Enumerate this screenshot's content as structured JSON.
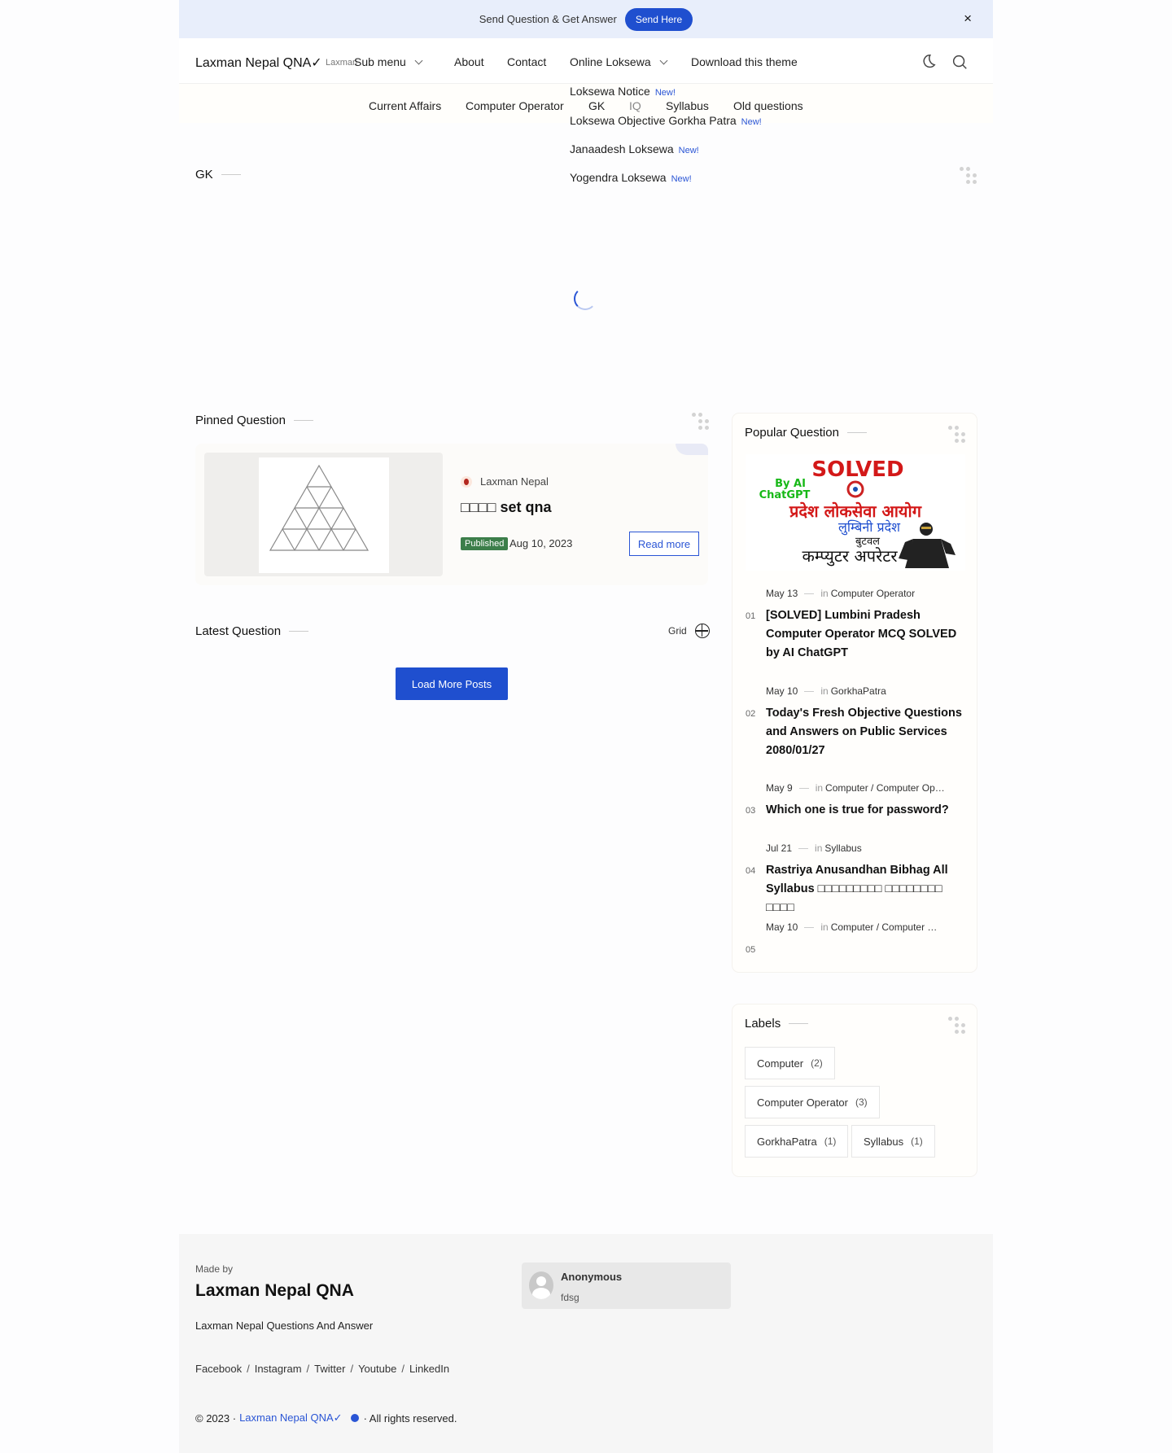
{
  "notice": {
    "text": "Send Question & Get Answer",
    "button": "Send Here",
    "close": "×"
  },
  "header": {
    "brand": "Laxman Nepal QNA✓",
    "brand_sub": "Laxman",
    "nav": {
      "submenu": "Sub menu",
      "about": "About",
      "contact": "Contact",
      "online_loksewa": "Online Loksewa",
      "download": "Download this theme"
    },
    "icons": [
      "moon-icon",
      "search-icon"
    ]
  },
  "subnav": [
    "Current Affairs",
    "Computer Operator",
    "GK",
    "IQ",
    "Syllabus",
    "Old questions"
  ],
  "dropdown": {
    "new_badge": "New!",
    "items": [
      "Loksewa Notice",
      "Loksewa Objective Gorkha Patra",
      "Janaadesh Loksewa",
      "Yogendra Loksewa"
    ]
  },
  "gk_section": {
    "title": "GK"
  },
  "pinned": {
    "title": "Pinned Question",
    "author": "Laxman Nepal",
    "post_title": "□□□□ set qna",
    "status": "Published",
    "date": "Aug 10, 2023",
    "read_more": "Read more"
  },
  "latest": {
    "title": "Latest Question",
    "toggle": "Grid",
    "load_more": "Load More Posts"
  },
  "popular": {
    "title": "Popular Question",
    "image_text": {
      "solved": "SOLVED",
      "by_ai": "By AI",
      "chatgpt": "ChatGPT",
      "line1": "प्रदेश लोकसेवा आयोग",
      "line2": "लुम्बिनी प्रदेश",
      "line3": "बुटवल",
      "line4": "कम्प्युटर अपरेटर"
    },
    "in_label": "in",
    "items": [
      {
        "num": "01",
        "date": "May 13",
        "category": "Computer Operator",
        "title": "[SOLVED] Lumbini Pradesh Computer Operator MCQ SOLVED by AI ChatGPT"
      },
      {
        "num": "02",
        "date": "May 10",
        "category": "GorkhaPatra",
        "title": "Today's Fresh Objective Questions and Answers on Public Services 2080/01/27"
      },
      {
        "num": "03",
        "date": "May 9",
        "category": "Computer / Computer Operator",
        "title": "Which one is true for password?"
      },
      {
        "num": "04",
        "date": "Jul 21",
        "category": "Syllabus",
        "title": "Rastriya Anusandhan Bibhag All Syllabus □□□□□□□□□ □□□□□□□□ □□□□"
      },
      {
        "num": "05",
        "date": "May 10",
        "category": "Computer / Computer Operator",
        "title": ""
      }
    ]
  },
  "labels": {
    "title": "Labels",
    "items": [
      {
        "name": "Computer",
        "count": "(2)"
      },
      {
        "name": "Computer Operator",
        "count": "(3)"
      },
      {
        "name": "GorkhaPatra",
        "count": "(1)"
      },
      {
        "name": "Syllabus",
        "count": "(1)"
      }
    ]
  },
  "footer": {
    "made_by": "Made by",
    "brand": "Laxman Nepal QNA",
    "description": "Laxman Nepal Questions And Answer",
    "links": [
      "Facebook",
      "Instagram",
      "Twitter",
      "Youtube",
      "LinkedIn"
    ],
    "link_sep": "/",
    "copyright_prefix": "© 2023 ·",
    "copyright_site": "Laxman Nepal QNA✓",
    "copyright_suffix": "· All rights reserved.",
    "comment": {
      "name": "Anonymous",
      "text": "fdsg"
    }
  },
  "colors": {
    "accent": "#1f4fcf",
    "notice_bg": "#e8eefb",
    "published": "#3c7e4a"
  }
}
